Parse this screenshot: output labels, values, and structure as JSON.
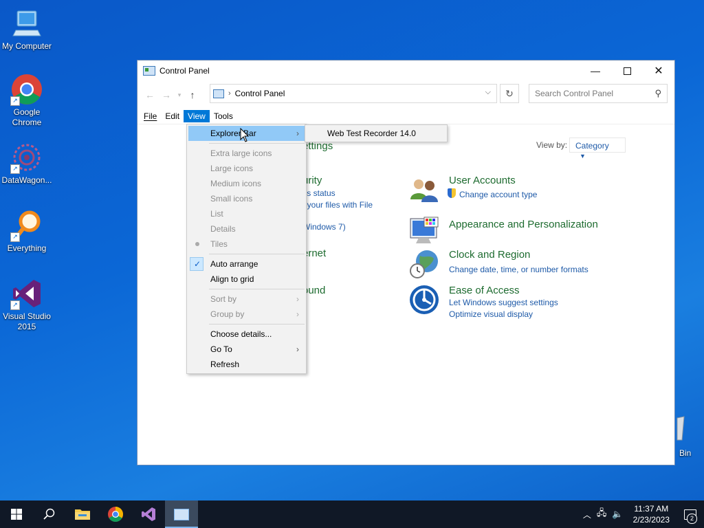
{
  "desktop": {
    "icons": [
      {
        "label": "My Computer"
      },
      {
        "label": "Google Chrome"
      },
      {
        "label": "DataWagon..."
      },
      {
        "label": "Everything"
      },
      {
        "label": "Visual Studio 2015"
      },
      {
        "label": "Bin"
      }
    ]
  },
  "window": {
    "title": "Control Panel",
    "address": "Control Panel",
    "search_placeholder": "Search Control Panel",
    "menubar": [
      "File",
      "Edit",
      "View",
      "Tools"
    ],
    "view_by_label": "View by:",
    "view_by_value": "Category",
    "fragments": [
      "ettings",
      "urity",
      "r's status",
      "f your files with File",
      "Windows 7)",
      "ernet",
      "ound"
    ],
    "categories": [
      {
        "heading": "User Accounts",
        "links": [
          "Change account type"
        ]
      },
      {
        "heading": "Appearance and Personalization",
        "links": []
      },
      {
        "heading": "Clock and Region",
        "links": [
          "Change date, time, or number formats"
        ]
      },
      {
        "heading": "Ease of Access",
        "links": [
          "Let Windows suggest settings",
          "Optimize visual display"
        ]
      }
    ]
  },
  "view_menu": {
    "items": [
      "Explorer Bar",
      "Extra large icons",
      "Large icons",
      "Medium icons",
      "Small icons",
      "List",
      "Details",
      "Tiles",
      "Auto arrange",
      "Align to grid",
      "Sort by",
      "Group by",
      "Choose details...",
      "Go To",
      "Refresh"
    ],
    "submenu_item": "Web Test Recorder 14.0"
  },
  "taskbar": {
    "time": "11:37 AM",
    "date": "2/23/2023",
    "notifications": "2"
  },
  "colors": {
    "accent": "#0078d7",
    "link": "#1e5aa8",
    "heading": "#1d6b2f",
    "highlight": "#91c9f7"
  }
}
